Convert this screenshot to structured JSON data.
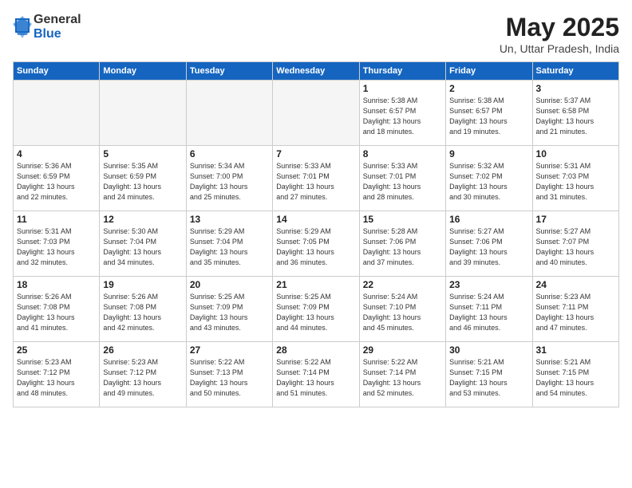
{
  "logo": {
    "general": "General",
    "blue": "Blue"
  },
  "title": {
    "month": "May 2025",
    "location": "Un, Uttar Pradesh, India"
  },
  "weekdays": [
    "Sunday",
    "Monday",
    "Tuesday",
    "Wednesday",
    "Thursday",
    "Friday",
    "Saturday"
  ],
  "weeks": [
    [
      {
        "day": "",
        "info": ""
      },
      {
        "day": "",
        "info": ""
      },
      {
        "day": "",
        "info": ""
      },
      {
        "day": "",
        "info": ""
      },
      {
        "day": "1",
        "info": "Sunrise: 5:38 AM\nSunset: 6:57 PM\nDaylight: 13 hours\nand 18 minutes."
      },
      {
        "day": "2",
        "info": "Sunrise: 5:38 AM\nSunset: 6:57 PM\nDaylight: 13 hours\nand 19 minutes."
      },
      {
        "day": "3",
        "info": "Sunrise: 5:37 AM\nSunset: 6:58 PM\nDaylight: 13 hours\nand 21 minutes."
      }
    ],
    [
      {
        "day": "4",
        "info": "Sunrise: 5:36 AM\nSunset: 6:59 PM\nDaylight: 13 hours\nand 22 minutes."
      },
      {
        "day": "5",
        "info": "Sunrise: 5:35 AM\nSunset: 6:59 PM\nDaylight: 13 hours\nand 24 minutes."
      },
      {
        "day": "6",
        "info": "Sunrise: 5:34 AM\nSunset: 7:00 PM\nDaylight: 13 hours\nand 25 minutes."
      },
      {
        "day": "7",
        "info": "Sunrise: 5:33 AM\nSunset: 7:01 PM\nDaylight: 13 hours\nand 27 minutes."
      },
      {
        "day": "8",
        "info": "Sunrise: 5:33 AM\nSunset: 7:01 PM\nDaylight: 13 hours\nand 28 minutes."
      },
      {
        "day": "9",
        "info": "Sunrise: 5:32 AM\nSunset: 7:02 PM\nDaylight: 13 hours\nand 30 minutes."
      },
      {
        "day": "10",
        "info": "Sunrise: 5:31 AM\nSunset: 7:03 PM\nDaylight: 13 hours\nand 31 minutes."
      }
    ],
    [
      {
        "day": "11",
        "info": "Sunrise: 5:31 AM\nSunset: 7:03 PM\nDaylight: 13 hours\nand 32 minutes."
      },
      {
        "day": "12",
        "info": "Sunrise: 5:30 AM\nSunset: 7:04 PM\nDaylight: 13 hours\nand 34 minutes."
      },
      {
        "day": "13",
        "info": "Sunrise: 5:29 AM\nSunset: 7:04 PM\nDaylight: 13 hours\nand 35 minutes."
      },
      {
        "day": "14",
        "info": "Sunrise: 5:29 AM\nSunset: 7:05 PM\nDaylight: 13 hours\nand 36 minutes."
      },
      {
        "day": "15",
        "info": "Sunrise: 5:28 AM\nSunset: 7:06 PM\nDaylight: 13 hours\nand 37 minutes."
      },
      {
        "day": "16",
        "info": "Sunrise: 5:27 AM\nSunset: 7:06 PM\nDaylight: 13 hours\nand 39 minutes."
      },
      {
        "day": "17",
        "info": "Sunrise: 5:27 AM\nSunset: 7:07 PM\nDaylight: 13 hours\nand 40 minutes."
      }
    ],
    [
      {
        "day": "18",
        "info": "Sunrise: 5:26 AM\nSunset: 7:08 PM\nDaylight: 13 hours\nand 41 minutes."
      },
      {
        "day": "19",
        "info": "Sunrise: 5:26 AM\nSunset: 7:08 PM\nDaylight: 13 hours\nand 42 minutes."
      },
      {
        "day": "20",
        "info": "Sunrise: 5:25 AM\nSunset: 7:09 PM\nDaylight: 13 hours\nand 43 minutes."
      },
      {
        "day": "21",
        "info": "Sunrise: 5:25 AM\nSunset: 7:09 PM\nDaylight: 13 hours\nand 44 minutes."
      },
      {
        "day": "22",
        "info": "Sunrise: 5:24 AM\nSunset: 7:10 PM\nDaylight: 13 hours\nand 45 minutes."
      },
      {
        "day": "23",
        "info": "Sunrise: 5:24 AM\nSunset: 7:11 PM\nDaylight: 13 hours\nand 46 minutes."
      },
      {
        "day": "24",
        "info": "Sunrise: 5:23 AM\nSunset: 7:11 PM\nDaylight: 13 hours\nand 47 minutes."
      }
    ],
    [
      {
        "day": "25",
        "info": "Sunrise: 5:23 AM\nSunset: 7:12 PM\nDaylight: 13 hours\nand 48 minutes."
      },
      {
        "day": "26",
        "info": "Sunrise: 5:23 AM\nSunset: 7:12 PM\nDaylight: 13 hours\nand 49 minutes."
      },
      {
        "day": "27",
        "info": "Sunrise: 5:22 AM\nSunset: 7:13 PM\nDaylight: 13 hours\nand 50 minutes."
      },
      {
        "day": "28",
        "info": "Sunrise: 5:22 AM\nSunset: 7:14 PM\nDaylight: 13 hours\nand 51 minutes."
      },
      {
        "day": "29",
        "info": "Sunrise: 5:22 AM\nSunset: 7:14 PM\nDaylight: 13 hours\nand 52 minutes."
      },
      {
        "day": "30",
        "info": "Sunrise: 5:21 AM\nSunset: 7:15 PM\nDaylight: 13 hours\nand 53 minutes."
      },
      {
        "day": "31",
        "info": "Sunrise: 5:21 AM\nSunset: 7:15 PM\nDaylight: 13 hours\nand 54 minutes."
      }
    ]
  ]
}
